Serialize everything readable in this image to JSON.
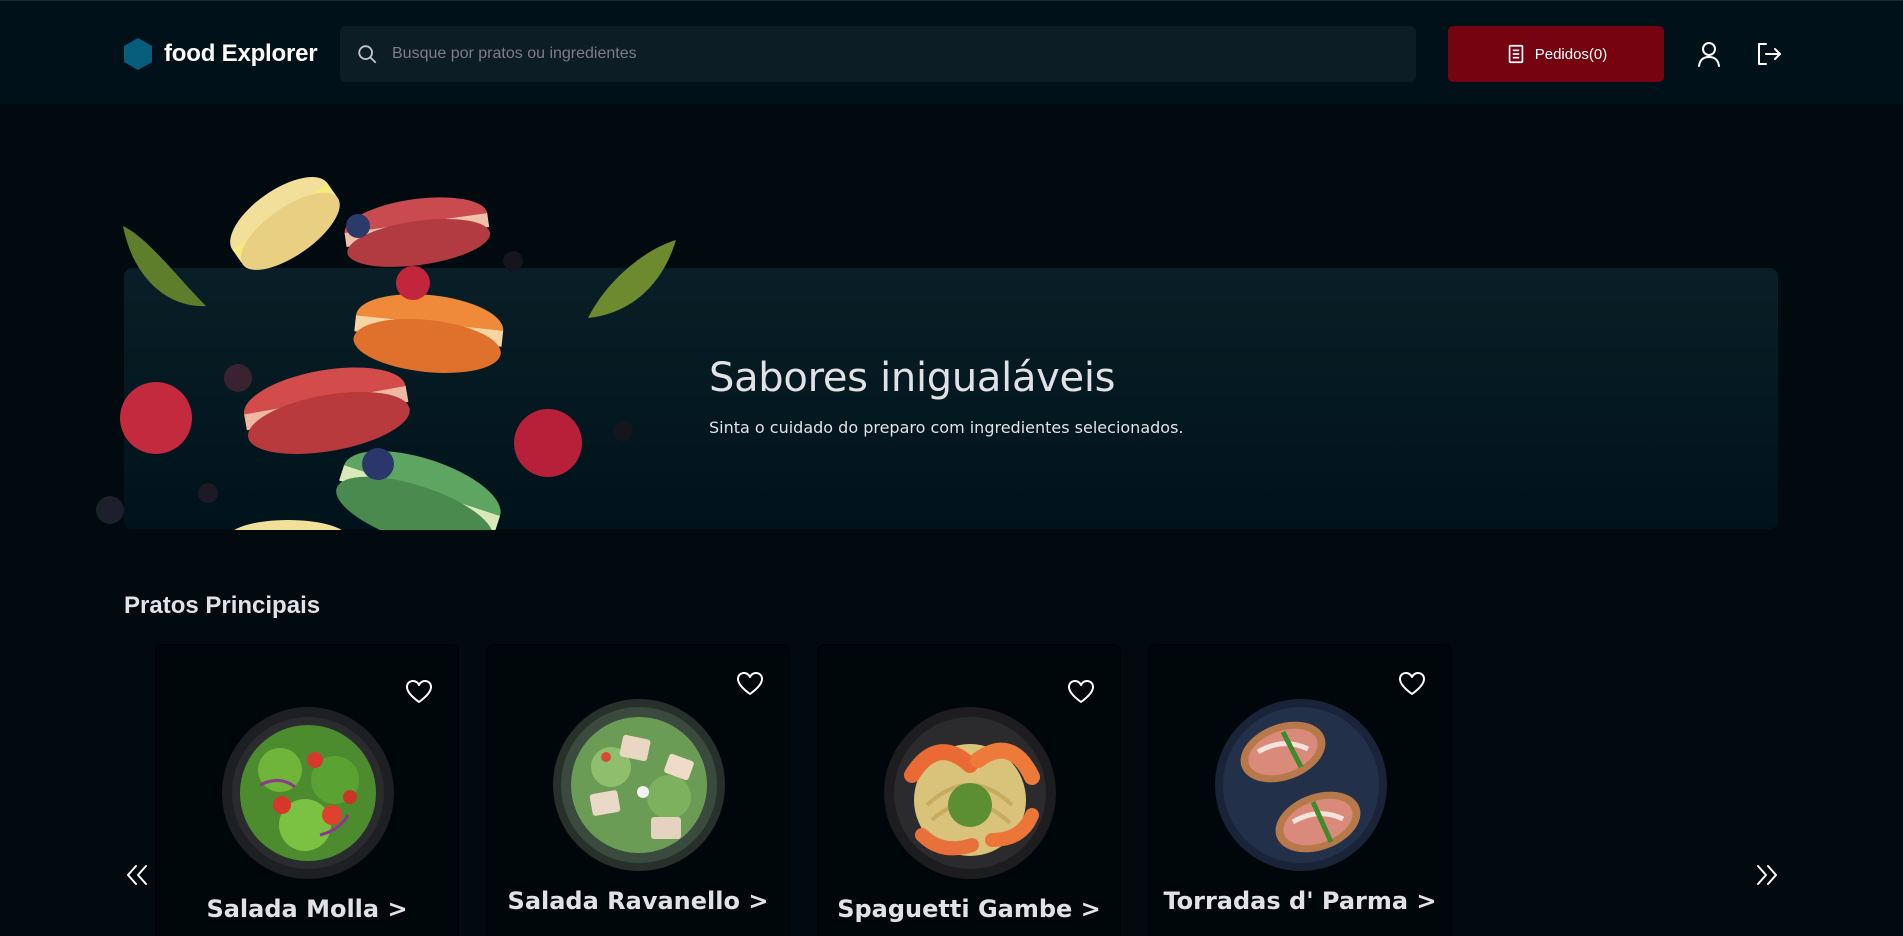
{
  "header": {
    "logo_text": "food Explorer",
    "search": {
      "placeholder": "Busque por pratos ou ingredientes",
      "value": ""
    },
    "orders_label": "Pedidos(0)",
    "icons": [
      "hexagon-logo-icon",
      "search-icon",
      "receipt-icon",
      "user-icon",
      "sign-out-icon"
    ]
  },
  "hero": {
    "title": "Sabores inigualáveis",
    "subtitle": "Sinta o cuidado do preparo com ingredientes selecionados."
  },
  "section": {
    "title": "Pratos Principais",
    "dishes": [
      {
        "name": "Salada Molla >",
        "favorite": false
      },
      {
        "name": "Salada Ravanello >",
        "favorite": false
      },
      {
        "name": "Spaguetti Gambe >",
        "favorite": false
      },
      {
        "name": "Torradas d' Parma >",
        "favorite": false
      }
    ],
    "nav_icons": [
      "chevrons-left-icon",
      "chevrons-right-icon"
    ]
  },
  "colors": {
    "background": "#000a0f",
    "header_bg": "#00111a",
    "search_bg": "#0d1d25",
    "accent": "#750310",
    "logo": "#065e7c",
    "card_bg": "#00070a",
    "text": "#e1e1e6"
  }
}
